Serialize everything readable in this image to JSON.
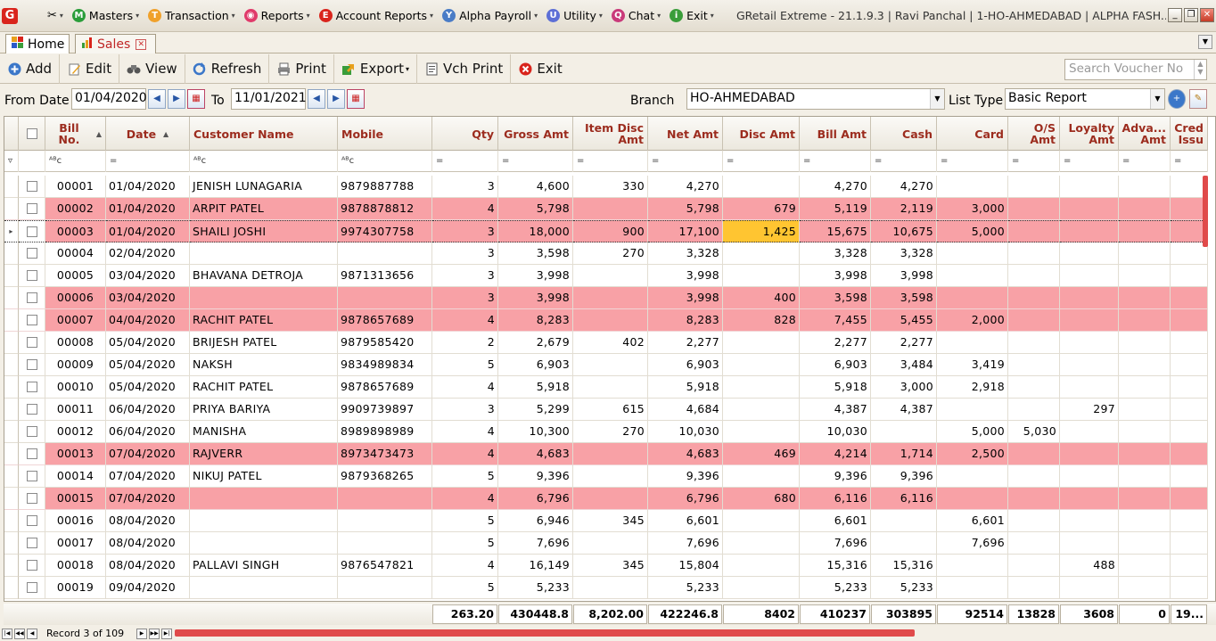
{
  "window": {
    "title": "GRetail Extreme - 21.1.9.3 | Ravi Panchal | 1-HO-AHMEDABAD | ALPHA FASH...",
    "logo": "G"
  },
  "menu": [
    {
      "label": "Masters",
      "icon": "M",
      "color": "#2a9d3a"
    },
    {
      "label": "Transaction",
      "icon": "T",
      "color": "#f0a12b"
    },
    {
      "label": "Reports",
      "icon": "◉",
      "color": "#e03a6a"
    },
    {
      "label": "Account Reports",
      "icon": "E",
      "color": "#d9241c"
    },
    {
      "label": "Alpha Payroll",
      "icon": "Y",
      "color": "#4a7cc6"
    },
    {
      "label": "Utility",
      "icon": "U",
      "color": "#5d6fd6"
    },
    {
      "label": "Chat",
      "icon": "Q",
      "color": "#c93a7a"
    },
    {
      "label": "Exit",
      "icon": "i",
      "color": "#3a9d3a"
    }
  ],
  "tabs": {
    "home": "Home",
    "sales": "Sales"
  },
  "toolbar": {
    "add": "Add",
    "edit": "Edit",
    "view": "View",
    "refresh": "Refresh",
    "print": "Print",
    "export": "Export",
    "vch_print": "Vch Print",
    "exit": "Exit",
    "search_placeholder": "Search Voucher No"
  },
  "filters": {
    "from_label": "From Date",
    "from_value": "01/04/2020",
    "to_label": "To",
    "to_value": "11/01/2021",
    "branch_label": "Branch",
    "branch_value": "HO-AHMEDABAD",
    "list_type_label": "List Type",
    "list_type_value": "Basic Report"
  },
  "columns": [
    {
      "key": "bill_no",
      "label": "Bill No.",
      "sort": true
    },
    {
      "key": "date",
      "label": "Date",
      "sort": true
    },
    {
      "key": "customer",
      "label": "Customer Name"
    },
    {
      "key": "mobile",
      "label": "Mobile"
    },
    {
      "key": "qty",
      "label": "Qty"
    },
    {
      "key": "gross",
      "label": "Gross Amt"
    },
    {
      "key": "item_disc",
      "label": "Item Disc Amt"
    },
    {
      "key": "net",
      "label": "Net Amt"
    },
    {
      "key": "disc",
      "label": "Disc Amt"
    },
    {
      "key": "bill_amt",
      "label": "Bill Amt"
    },
    {
      "key": "cash",
      "label": "Cash"
    },
    {
      "key": "card",
      "label": "Card"
    },
    {
      "key": "os",
      "label": "O/S Amt"
    },
    {
      "key": "loyalty",
      "label": "Loyalty Amt"
    },
    {
      "key": "adva",
      "label": "Adva... Amt"
    },
    {
      "key": "cred",
      "label": "Cred Issu"
    }
  ],
  "rows": [
    {
      "bill_no": "00001",
      "date": "01/04/2020",
      "customer": "JENISH LUNAGARIA",
      "mobile": "9879887788",
      "qty": "3",
      "gross": "4,600",
      "item_disc": "330",
      "net": "4,270",
      "disc": "",
      "bill_amt": "4,270",
      "cash": "4,270",
      "card": "",
      "os": "",
      "loyalty": "",
      "adva": "",
      "cred": "",
      "pink": false
    },
    {
      "bill_no": "00002",
      "date": "01/04/2020",
      "customer": "ARPIT PATEL",
      "mobile": "9878878812",
      "qty": "4",
      "gross": "5,798",
      "item_disc": "",
      "net": "5,798",
      "disc": "679",
      "bill_amt": "5,119",
      "cash": "2,119",
      "card": "3,000",
      "os": "",
      "loyalty": "",
      "adva": "",
      "cred": "",
      "pink": true
    },
    {
      "bill_no": "00003",
      "date": "01/04/2020",
      "customer": "SHAILI JOSHI",
      "mobile": "9974307758",
      "qty": "3",
      "gross": "18,000",
      "item_disc": "900",
      "net": "17,100",
      "disc": "1,425",
      "bill_amt": "15,675",
      "cash": "10,675",
      "card": "5,000",
      "os": "",
      "loyalty": "",
      "adva": "",
      "cred": "",
      "pink": true,
      "selected": true
    },
    {
      "bill_no": "00004",
      "date": "02/04/2020",
      "customer": "",
      "mobile": "",
      "qty": "3",
      "gross": "3,598",
      "item_disc": "270",
      "net": "3,328",
      "disc": "",
      "bill_amt": "3,328",
      "cash": "3,328",
      "card": "",
      "os": "",
      "loyalty": "",
      "adva": "",
      "cred": "",
      "pink": false
    },
    {
      "bill_no": "00005",
      "date": "03/04/2020",
      "customer": "BHAVANA DETROJA",
      "mobile": "9871313656",
      "qty": "3",
      "gross": "3,998",
      "item_disc": "",
      "net": "3,998",
      "disc": "",
      "bill_amt": "3,998",
      "cash": "3,998",
      "card": "",
      "os": "",
      "loyalty": "",
      "adva": "",
      "cred": "",
      "pink": false
    },
    {
      "bill_no": "00006",
      "date": "03/04/2020",
      "customer": "",
      "mobile": "",
      "qty": "3",
      "gross": "3,998",
      "item_disc": "",
      "net": "3,998",
      "disc": "400",
      "bill_amt": "3,598",
      "cash": "3,598",
      "card": "",
      "os": "",
      "loyalty": "",
      "adva": "",
      "cred": "",
      "pink": true
    },
    {
      "bill_no": "00007",
      "date": "04/04/2020",
      "customer": "RACHIT PATEL",
      "mobile": "9878657689",
      "qty": "4",
      "gross": "8,283",
      "item_disc": "",
      "net": "8,283",
      "disc": "828",
      "bill_amt": "7,455",
      "cash": "5,455",
      "card": "2,000",
      "os": "",
      "loyalty": "",
      "adva": "",
      "cred": "",
      "pink": true
    },
    {
      "bill_no": "00008",
      "date": "05/04/2020",
      "customer": "BRIJESH PATEL",
      "mobile": "9879585420",
      "qty": "2",
      "gross": "2,679",
      "item_disc": "402",
      "net": "2,277",
      "disc": "",
      "bill_amt": "2,277",
      "cash": "2,277",
      "card": "",
      "os": "",
      "loyalty": "",
      "adva": "",
      "cred": "",
      "pink": false
    },
    {
      "bill_no": "00009",
      "date": "05/04/2020",
      "customer": "NAKSH",
      "mobile": "9834989834",
      "qty": "5",
      "gross": "6,903",
      "item_disc": "",
      "net": "6,903",
      "disc": "",
      "bill_amt": "6,903",
      "cash": "3,484",
      "card": "3,419",
      "os": "",
      "loyalty": "",
      "adva": "",
      "cred": "",
      "pink": false
    },
    {
      "bill_no": "00010",
      "date": "05/04/2020",
      "customer": "RACHIT PATEL",
      "mobile": "9878657689",
      "qty": "4",
      "gross": "5,918",
      "item_disc": "",
      "net": "5,918",
      "disc": "",
      "bill_amt": "5,918",
      "cash": "3,000",
      "card": "2,918",
      "os": "",
      "loyalty": "",
      "adva": "",
      "cred": "",
      "pink": false
    },
    {
      "bill_no": "00011",
      "date": "06/04/2020",
      "customer": "PRIYA BARIYA",
      "mobile": "9909739897",
      "qty": "3",
      "gross": "5,299",
      "item_disc": "615",
      "net": "4,684",
      "disc": "",
      "bill_amt": "4,387",
      "cash": "4,387",
      "card": "",
      "os": "",
      "loyalty": "297",
      "adva": "",
      "cred": "",
      "pink": false
    },
    {
      "bill_no": "00012",
      "date": "06/04/2020",
      "customer": "MANISHA",
      "mobile": "8989898989",
      "qty": "4",
      "gross": "10,300",
      "item_disc": "270",
      "net": "10,030",
      "disc": "",
      "bill_amt": "10,030",
      "cash": "",
      "card": "5,000",
      "os": "5,030",
      "loyalty": "",
      "adva": "",
      "cred": "",
      "pink": false
    },
    {
      "bill_no": "00013",
      "date": "07/04/2020",
      "customer": "RAJVERR",
      "mobile": "8973473473",
      "qty": "4",
      "gross": "4,683",
      "item_disc": "",
      "net": "4,683",
      "disc": "469",
      "bill_amt": "4,214",
      "cash": "1,714",
      "card": "2,500",
      "os": "",
      "loyalty": "",
      "adva": "",
      "cred": "",
      "pink": true
    },
    {
      "bill_no": "00014",
      "date": "07/04/2020",
      "customer": "NIKUJ PATEL",
      "mobile": "9879368265",
      "qty": "5",
      "gross": "9,396",
      "item_disc": "",
      "net": "9,396",
      "disc": "",
      "bill_amt": "9,396",
      "cash": "9,396",
      "card": "",
      "os": "",
      "loyalty": "",
      "adva": "",
      "cred": "",
      "pink": false
    },
    {
      "bill_no": "00015",
      "date": "07/04/2020",
      "customer": "",
      "mobile": "",
      "qty": "4",
      "gross": "6,796",
      "item_disc": "",
      "net": "6,796",
      "disc": "680",
      "bill_amt": "6,116",
      "cash": "6,116",
      "card": "",
      "os": "",
      "loyalty": "",
      "adva": "",
      "cred": "",
      "pink": true
    },
    {
      "bill_no": "00016",
      "date": "08/04/2020",
      "customer": "",
      "mobile": "",
      "qty": "5",
      "gross": "6,946",
      "item_disc": "345",
      "net": "6,601",
      "disc": "",
      "bill_amt": "6,601",
      "cash": "",
      "card": "6,601",
      "os": "",
      "loyalty": "",
      "adva": "",
      "cred": "",
      "pink": false
    },
    {
      "bill_no": "00017",
      "date": "08/04/2020",
      "customer": "",
      "mobile": "",
      "qty": "5",
      "gross": "7,696",
      "item_disc": "",
      "net": "7,696",
      "disc": "",
      "bill_amt": "7,696",
      "cash": "",
      "card": "7,696",
      "os": "",
      "loyalty": "",
      "adva": "",
      "cred": "",
      "pink": false
    },
    {
      "bill_no": "00018",
      "date": "08/04/2020",
      "customer": "PALLAVI SINGH",
      "mobile": "9876547821",
      "qty": "4",
      "gross": "16,149",
      "item_disc": "345",
      "net": "15,804",
      "disc": "",
      "bill_amt": "15,316",
      "cash": "15,316",
      "card": "",
      "os": "",
      "loyalty": "488",
      "adva": "",
      "cred": "",
      "pink": false
    },
    {
      "bill_no": "00019",
      "date": "09/04/2020",
      "customer": "",
      "mobile": "",
      "qty": "5",
      "gross": "5,233",
      "item_disc": "",
      "net": "5,233",
      "disc": "",
      "bill_amt": "5,233",
      "cash": "5,233",
      "card": "",
      "os": "",
      "loyalty": "",
      "adva": "",
      "cred": "",
      "pink": false
    }
  ],
  "totals": {
    "qty": "263.20",
    "gross": "430448.8",
    "item_disc": "8,202.00",
    "net": "422246.8",
    "disc": "8402",
    "bill_amt": "410237",
    "cash": "303895",
    "card": "92514",
    "os": "13828",
    "loyalty": "3608",
    "adva": "0",
    "cred": "19..."
  },
  "status": {
    "record_text": "Record 3 of 109"
  },
  "colors": {
    "pink_row": "#f8a1a6",
    "highlight": "#ffc531",
    "header_text": "#9c2c1e"
  }
}
